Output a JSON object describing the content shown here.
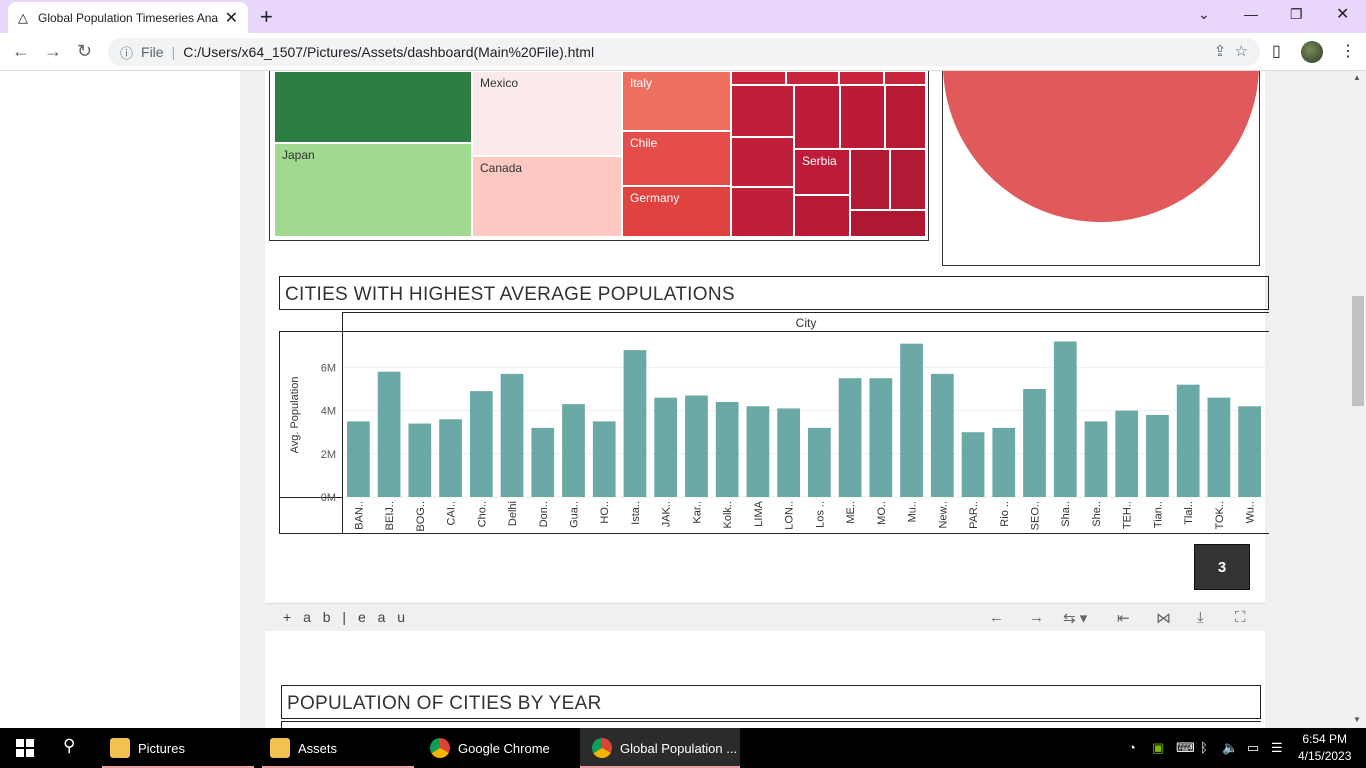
{
  "browser": {
    "tab_title": "Global Population Timeseries Ana",
    "file_label": "File",
    "url": "C:/Users/x64_1507/Pictures/Assets/dashboard(Main%20File).html"
  },
  "treemap": {
    "cells": [
      "Mexico",
      "Japan",
      "Canada",
      "Italy",
      "Chile",
      "Germany",
      "Serbia"
    ]
  },
  "chart_section": {
    "title": "CITIES WITH HIGHEST AVERAGE POPULATIONS"
  },
  "chart_data": {
    "type": "bar",
    "title": "CITIES WITH HIGHEST AVERAGE POPULATIONS",
    "xlabel": "City",
    "ylabel": "Avg. Population",
    "categories": [
      "BAN..",
      "BEIJ..",
      "BOG..",
      "CAI..",
      "Cho..",
      "Delhi",
      "Don..",
      "Gua..",
      "HO..",
      "Ista..",
      "JAK..",
      "Kar..",
      "Kolk..",
      "LIMA",
      "LON..",
      "Los ..",
      "ME..",
      "MO..",
      "Mu..",
      "New..",
      "PAR..",
      "Rio ..",
      "SEO..",
      "Sha..",
      "She..",
      "TEH..",
      "Tian..",
      "Tlal..",
      "TOK..",
      "Wu.."
    ],
    "values": [
      3.5,
      5.8,
      3.4,
      3.6,
      4.9,
      5.7,
      3.2,
      4.3,
      3.5,
      6.8,
      4.6,
      4.7,
      4.4,
      4.2,
      4.1,
      3.2,
      5.5,
      5.5,
      7.1,
      5.7,
      3.0,
      3.2,
      5.0,
      7.2,
      3.5,
      4.0,
      3.8,
      5.2,
      4.6,
      4.2
    ],
    "yticks": [
      "0M",
      "2M",
      "4M",
      "6M"
    ],
    "ylim": [
      0,
      7.5
    ],
    "color": "#6aa9a5"
  },
  "page_badge": "3",
  "tableau_logo": "+ a b | e a u",
  "section2": {
    "title": "POPULATION OF CITIES BY YEAR"
  },
  "taskbar": {
    "items": [
      "Pictures",
      "Assets",
      "Google Chrome",
      "Global Population ..."
    ],
    "time": "6:54 PM",
    "date": "4/15/2023"
  }
}
